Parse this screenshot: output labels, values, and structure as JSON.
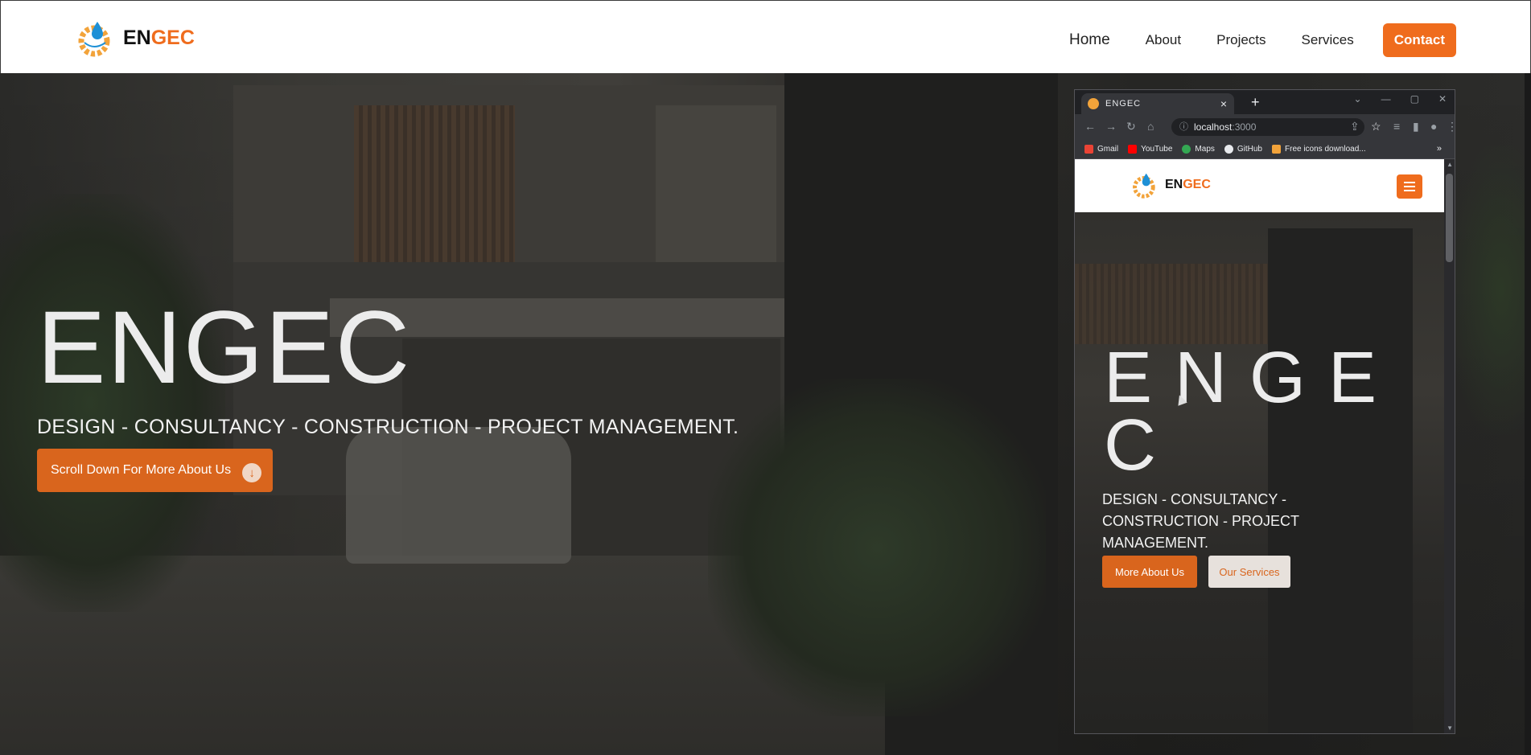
{
  "brand": {
    "part1": "EN",
    "part2": "GEC"
  },
  "nav": {
    "home": "Home",
    "about": "About",
    "projects": "Projects",
    "services": "Services",
    "contact": "Contact"
  },
  "hero": {
    "title": "ENGEC",
    "subtitle": "DESIGN - CONSULTANCY - CONSTRUCTION - PROJECT MANAGEMENT.",
    "button": "Scroll Down For More About Us",
    "button_icon": "arrow-down-circle-icon"
  },
  "browser": {
    "tab_title": "ENGEC",
    "new_tab": "+",
    "url_host": "localhost",
    "url_port": ":3000",
    "bookmarks": [
      {
        "label": "Gmail",
        "color": "#ea4335"
      },
      {
        "label": "YouTube",
        "color": "#ff0000"
      },
      {
        "label": "Maps",
        "color": "#34a853"
      },
      {
        "label": "GitHub",
        "color": "#e8eaed"
      },
      {
        "label": "Free icons download...",
        "color": "#f2a33a"
      }
    ],
    "bookmarks_more": "»"
  },
  "mobile": {
    "title": "ENGEC",
    "subtitle": "DESIGN - CONSULTANCY - CONSTRUCTION - PROJECT MANAGEMENT.",
    "button_primary": "More About Us",
    "button_secondary": "Our Services"
  },
  "colors": {
    "accent": "#ef6c1d",
    "button": "#d9651d"
  }
}
